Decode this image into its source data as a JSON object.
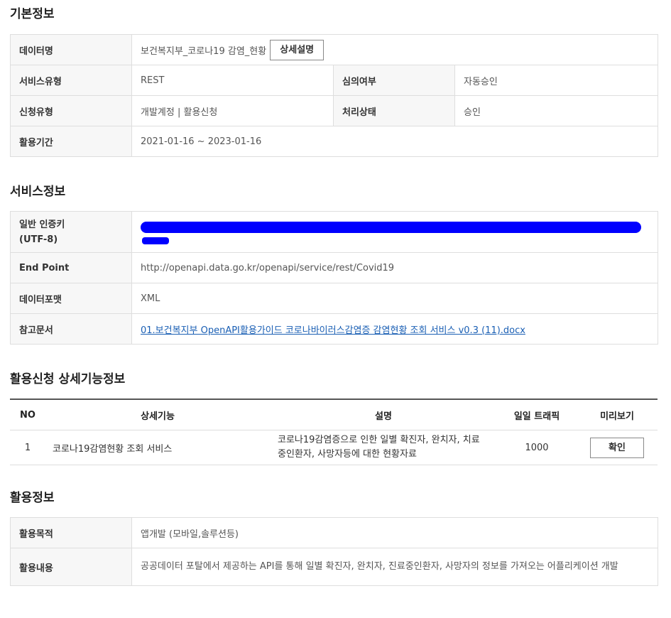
{
  "basic": {
    "title": "기본정보",
    "data_name_label": "데이터명",
    "data_name_value": "보건복지부_코로나19 감염_현황",
    "detail_button": "상세설명",
    "service_type_label": "서비스유형",
    "service_type_value": "REST",
    "review_label": "심의여부",
    "review_value": "자동승인",
    "apply_type_label": "신청유형",
    "apply_type_value": "개발계정 | 활용신청",
    "process_label": "처리상태",
    "process_value": "승인",
    "period_label": "활용기간",
    "period_value": "2021-01-16 ~ 2023-01-16"
  },
  "service": {
    "title": "서비스정보",
    "key_label_line1": "일반 인증키",
    "key_label_line2": "(UTF-8)",
    "endpoint_label": "End Point",
    "endpoint_value": "http://openapi.data.go.kr/openapi/service/rest/Covid19",
    "format_label": "데이터포맷",
    "format_value": "XML",
    "doc_label": "참고문서",
    "doc_link": "01.보건복지부 OpenAPI활용가이드 코로나바이러스감염증 감염현황 조회 서비스 v0.3 (11).docx"
  },
  "functions": {
    "title": "활용신청 상세기능정보",
    "headers": [
      "NO",
      "상세기능",
      "설명",
      "일일 트래픽",
      "미리보기"
    ],
    "rows": [
      {
        "no": "1",
        "name": "코로나19감염현황 조회 서비스",
        "desc": "코로나19감염증으로 인한 일별 확진자, 완치자, 치료중인환자, 사망자등에 대한 현황자료",
        "traffic": "1000",
        "action": "확인"
      }
    ]
  },
  "usage": {
    "title": "활용정보",
    "purpose_label": "활용목적",
    "purpose_value": "앱개발 (모바일,솔루션등)",
    "content_label": "활용내용",
    "content_value": "공공데이터 포탈에서 제공하는 API를 통해 일별 확진자, 완치자, 진료중인환자, 사망자의 정보를 가져오는 어플리케이션 개발"
  },
  "redaction_color": "#0000ff"
}
